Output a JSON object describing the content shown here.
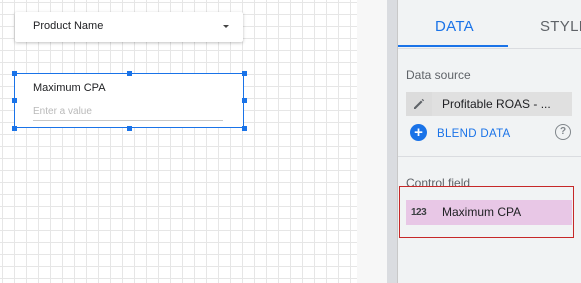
{
  "canvas": {
    "dropdown_control": {
      "label": "Product Name"
    },
    "input_control": {
      "title": "Maximum CPA",
      "placeholder": "Enter a value",
      "value": ""
    }
  },
  "panel": {
    "tabs": [
      {
        "label": "DATA",
        "active": true
      },
      {
        "label": "STYLE",
        "active": false
      }
    ],
    "data_source": {
      "title": "Data source",
      "name": "Profitable ROAS - ...",
      "edit_icon": "pencil-icon"
    },
    "blend": {
      "label": "BLEND DATA",
      "icon": "plus-circle-icon",
      "help_icon": "help-icon"
    },
    "control_field": {
      "title": "Control field",
      "type_icon": "123",
      "name": "Maximum CPA"
    }
  },
  "colors": {
    "accent": "#1a73e8",
    "control_field_bg": "#e8c7e6",
    "highlight_border": "#c62828",
    "panel_bg": "#f1f3f4"
  }
}
